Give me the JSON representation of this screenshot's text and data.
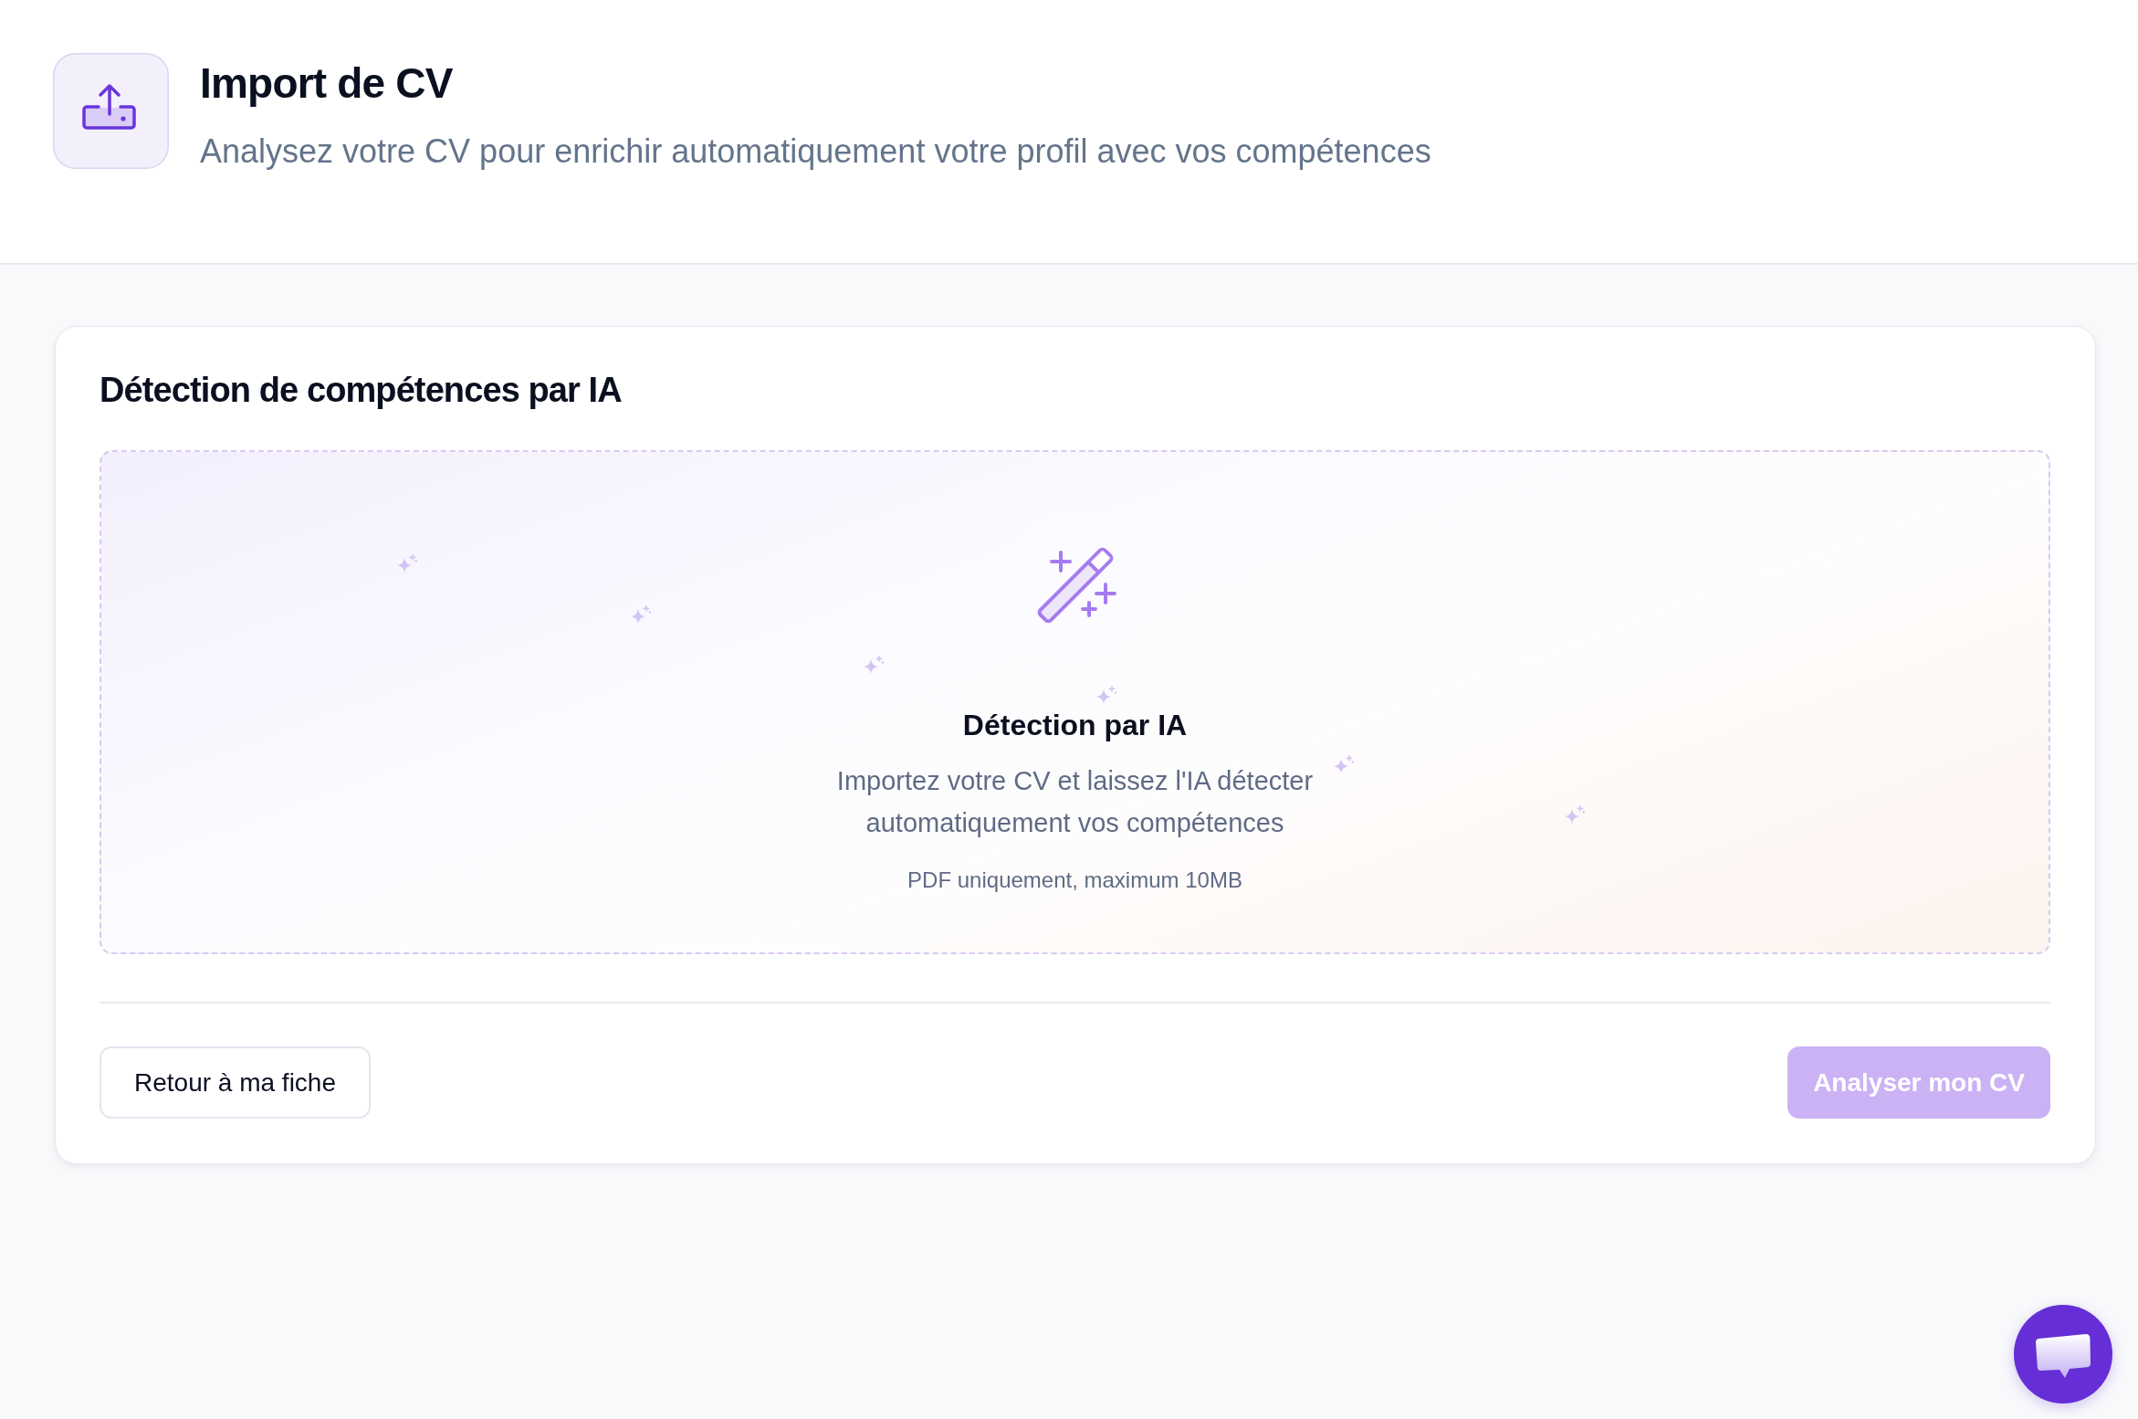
{
  "header": {
    "title": "Import de CV",
    "subtitle": "Analysez votre CV pour enrichir automatiquement votre profil avec vos compétences"
  },
  "card": {
    "title": "Détection de compétences par IA",
    "dropzone": {
      "title": "Détection par IA",
      "description": "Importez votre CV et laissez l'IA détecter automatiquement vos compétences",
      "hint": "PDF uniquement, maximum 10MB"
    },
    "actions": [
      {
        "label": "Retour à ma fiche",
        "kind": "secondary",
        "disabled": false
      },
      {
        "label": "Analyser mon CV",
        "kind": "primary",
        "disabled": true
      }
    ]
  }
}
